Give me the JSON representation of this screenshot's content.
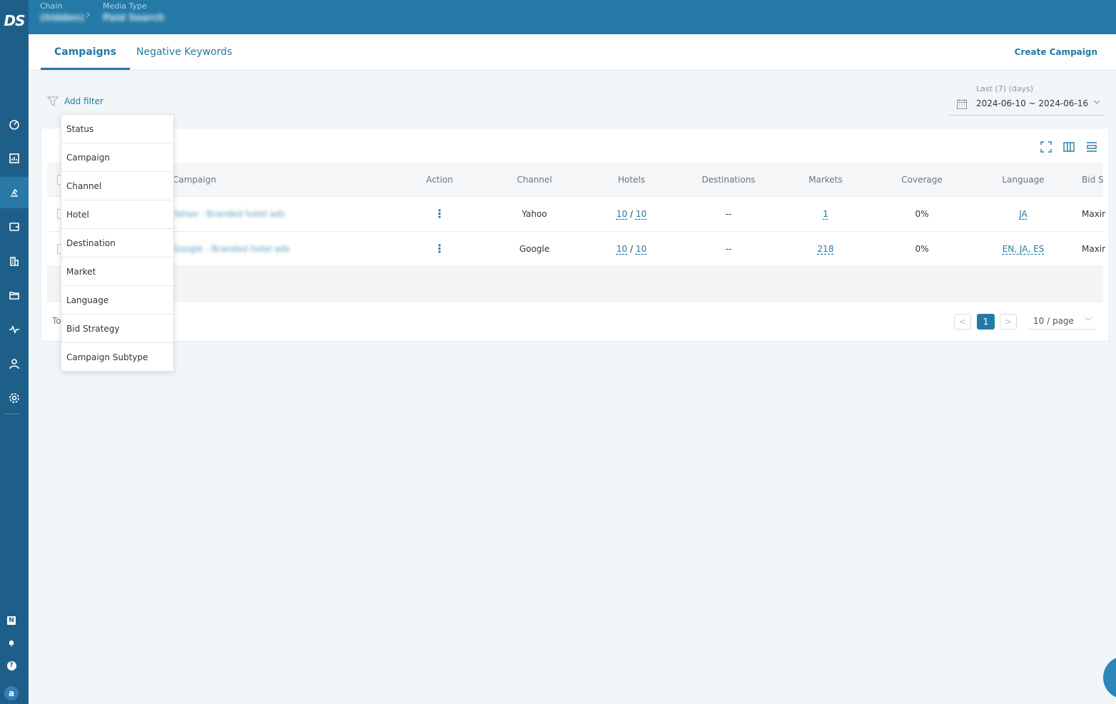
{
  "app": {
    "logo": "DS"
  },
  "breadcrumb": {
    "chain_label": "Chain",
    "chain_value": "(hidden)",
    "media_label": "Media Type",
    "media_value": "Paid Search"
  },
  "tabs": [
    {
      "label": "Campaigns",
      "active": true
    },
    {
      "label": "Negative Keywords",
      "active": false
    }
  ],
  "create_label": "Create Campaign",
  "filter": {
    "label": "Add filter"
  },
  "date": {
    "label": "Last (7) (days)",
    "range": "2024-06-10 ~ 2024-06-16"
  },
  "filter_options": [
    "Status",
    "Campaign",
    "Channel",
    "Hotel",
    "Destination",
    "Market",
    "Language",
    "Bid Strategy",
    "Campaign Subtype"
  ],
  "table": {
    "columns": {
      "campaign": "Campaign",
      "action": "Action",
      "channel": "Channel",
      "hotels": "Hotels",
      "destinations": "Destinations",
      "markets": "Markets",
      "coverage": "Coverage",
      "language": "Language",
      "bid": "Bid S"
    },
    "rows": [
      {
        "campaign": "Yahoo - Branded hotel ads",
        "action": "⋮",
        "channel": "Yahoo",
        "hotels_a": "10",
        "hotels_sep": "/",
        "hotels_b": "10",
        "destinations": "--",
        "markets": "1",
        "coverage": "0%",
        "language": "JA",
        "bid": "Maxir"
      },
      {
        "campaign": "Google - Branded hotel ads",
        "action": "⋮",
        "channel": "Google",
        "hotels_a": "10",
        "hotels_sep": "/",
        "hotels_b": "10",
        "destinations": "--",
        "markets": "218",
        "coverage": "0%",
        "language": "EN, JA, ES",
        "bid": "Maxir"
      }
    ]
  },
  "pagination": {
    "total_prefix": "To",
    "prev": "<",
    "current": "1",
    "next": ">",
    "page_size": "10 / page"
  },
  "bottom_icons": {
    "badge": "N",
    "help": "?"
  },
  "avatar": "a",
  "colors": {
    "primary": "#2479a6",
    "sidebar": "#1e5f8a",
    "header": "#2479a6"
  }
}
